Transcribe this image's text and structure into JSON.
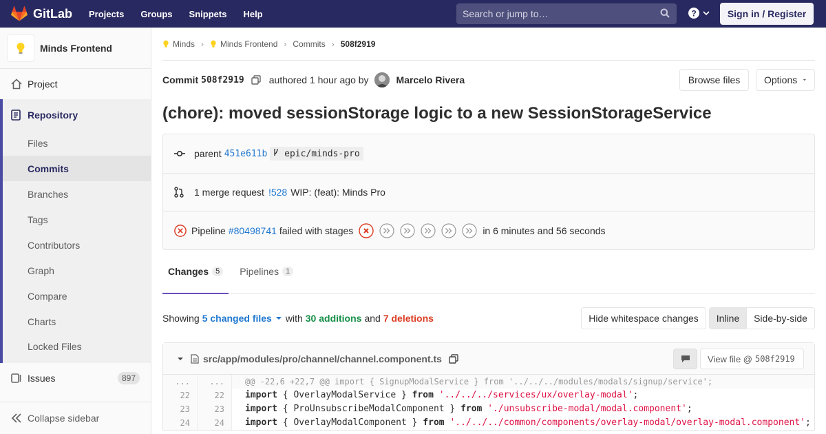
{
  "navbar": {
    "brand": "GitLab",
    "links": [
      "Projects",
      "Groups",
      "Snippets",
      "Help"
    ],
    "search_placeholder": "Search or jump to…",
    "signin": "Sign in / Register"
  },
  "sidebar": {
    "project_name": "Minds Frontend",
    "project": "Project",
    "repository": "Repository",
    "repo_items": [
      "Files",
      "Commits",
      "Branches",
      "Tags",
      "Contributors",
      "Graph",
      "Compare",
      "Charts",
      "Locked Files"
    ],
    "issues": "Issues",
    "issues_count": "897",
    "collapse": "Collapse sidebar"
  },
  "breadcrumb": {
    "items": [
      "Minds",
      "Minds Frontend",
      "Commits",
      "508f2919"
    ]
  },
  "commit": {
    "label": "Commit",
    "sha": "508f2919",
    "authored": "authored 1 hour ago by",
    "author": "Marcelo Rivera",
    "browse_files": "Browse files",
    "options": "Options",
    "title": "(chore): moved sessionStorage logic to a new SessionStorageService",
    "parent_label": "parent",
    "parent_sha": "451e611b",
    "branch": "epic/minds-pro",
    "mr_text": "1 merge request",
    "mr_id": "!528",
    "mr_title": "WIP: (feat): Minds Pro",
    "pipeline_label": "Pipeline",
    "pipeline_id": "#80498741",
    "pipeline_status": "failed with stages",
    "pipeline_duration": "in 6 minutes and 56 seconds"
  },
  "tabs": [
    {
      "label": "Changes",
      "count": "5"
    },
    {
      "label": "Pipelines",
      "count": "1"
    }
  ],
  "files_bar": {
    "showing": "Showing",
    "changed_files": "5 changed files",
    "with": "with",
    "additions": "30 additions",
    "and": "and",
    "deletions": "7 deletions",
    "hide_whitespace": "Hide whitespace changes",
    "inline": "Inline",
    "side_by_side": "Side-by-side"
  },
  "diff": {
    "path": "src/app/modules/pro/channel/channel.component.ts",
    "view_file": "View file @",
    "view_sha": "508f2919",
    "hunk_ln": "...",
    "hunk": "@@ -22,6 +22,7 @@ import { SignupModalService } from '../../../modules/modals/signup/service';",
    "lines": [
      {
        "old": "22",
        "new": "22",
        "kw": "import",
        "mid": " { OverlayModalService } ",
        "from": "from",
        "str": "'../../../services/ux/overlay-modal'",
        "end": ";"
      },
      {
        "old": "23",
        "new": "23",
        "kw": "import",
        "mid": " { ProUnsubscribeModalComponent } ",
        "from": "from",
        "str": "'./unsubscribe-modal/modal.component'",
        "end": ";"
      },
      {
        "old": "24",
        "new": "24",
        "kw": "import",
        "mid": " { OverlayModalComponent } ",
        "from": "from",
        "str": "'../../../common/components/overlay-modal/overlay-modal.component'",
        "end": ";"
      }
    ]
  }
}
